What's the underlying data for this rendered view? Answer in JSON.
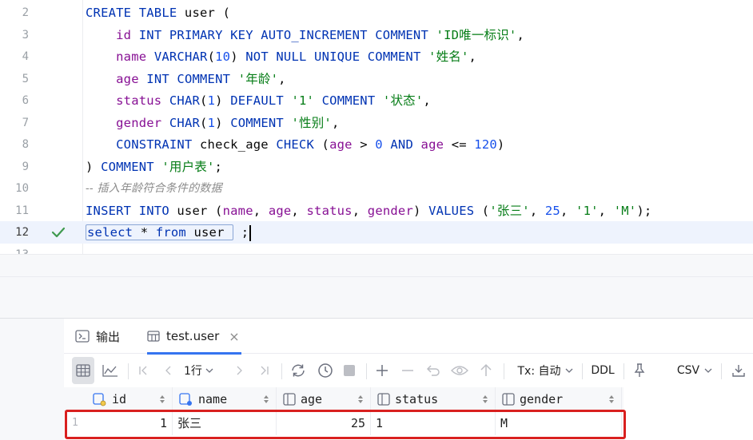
{
  "editor": {
    "lines": [
      {
        "num": "2"
      },
      {
        "num": "3",
        "comment": "'ID唯一标识'"
      },
      {
        "num": "4",
        "comment": "'姓名'"
      },
      {
        "num": "5",
        "comment": "'年龄'"
      },
      {
        "num": "6",
        "default": "'1'",
        "comment": "'状态'"
      },
      {
        "num": "7",
        "comment": "'性别'"
      },
      {
        "num": "8"
      },
      {
        "num": "9",
        "comment": "'用户表'"
      },
      {
        "num": "10",
        "text": "-- 插入年龄符合条件的数据"
      },
      {
        "num": "11",
        "v1": "'张三'",
        "v3": "'1'",
        "v4": "'M'"
      },
      {
        "num": "12"
      },
      {
        "num": "13"
      }
    ]
  },
  "tabs": {
    "output_label": "输出",
    "table_label": "test.user"
  },
  "toolbar": {
    "rows_label": "1行",
    "tx_label": "Tx: 自动",
    "ddl_label": "DDL",
    "csv_label": "CSV"
  },
  "grid": {
    "columns": [
      "id",
      "name",
      "age",
      "status",
      "gender"
    ],
    "rows": [
      {
        "num": "1",
        "id": "1",
        "name": "张三",
        "age": "25",
        "status": "1",
        "gender": "M"
      }
    ]
  },
  "colors": {
    "keyword": "#0033b3",
    "field": "#871094",
    "string": "#067d17",
    "number": "#1750eb",
    "highlight_border": "#d9201f",
    "accent": "#3574f0"
  }
}
